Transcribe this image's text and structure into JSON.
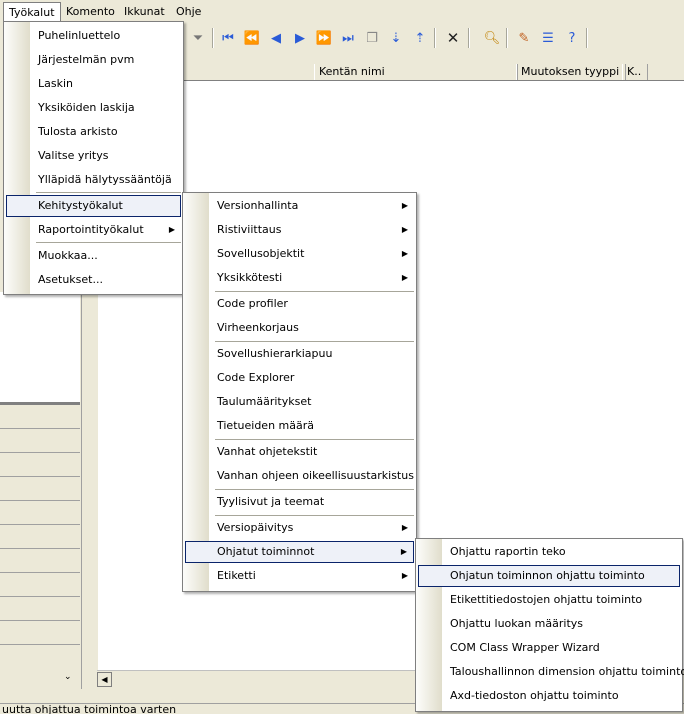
{
  "menubar": {
    "items": [
      "Työkalut",
      "Komento",
      "Ikkunat",
      "Ohje"
    ]
  },
  "toolbar": {
    "icons": [
      "filter-icon",
      "first-icon",
      "prev-page-icon",
      "prev-icon",
      "next-icon",
      "next-page-icon",
      "last-icon",
      "copy-icon",
      "import-icon",
      "export-icon",
      "delete-icon",
      "find-icon",
      "edit-icon",
      "list-icon",
      "help-icon"
    ]
  },
  "columns": [
    "Kentän nimi",
    "Muutoksen tyyppi",
    "K.."
  ],
  "status": {
    "text": "uutta ohjattua toimintoa varten"
  },
  "menu_tools": {
    "items": [
      "Puhelinluettelo",
      "Järjestelmän pvm",
      "Laskin",
      "Yksiköiden laskija",
      "Tulosta arkisto",
      "Valitse yritys",
      "Ylläpidä hälytyssääntöjä",
      "Kehitystyökalut",
      "Raportointityökalut",
      "Muokkaa...",
      "Asetukset..."
    ]
  },
  "menu_dev": {
    "items": [
      "Versionhallinta",
      "Ristiviittaus",
      "Sovellusobjektit",
      "Yksikkötesti",
      "Code profiler",
      "Virheenkorjaus",
      "Sovellushierarkiapuu",
      "Code Explorer",
      "Taulumääritykset",
      "Tietueiden määrä",
      "Vanhat ohjetekstit",
      "Vanhan ohjeen oikeellisuustarkistus",
      "Tyylisivut ja teemat",
      "Versiopäivitys",
      "Ohjatut toiminnot",
      "Etiketti"
    ]
  },
  "menu_wizards": {
    "items": [
      "Ohjattu raportin teko",
      "Ohjatun toiminnon ohjattu toiminto",
      "Etikettitiedostojen ohjattu toiminto",
      "Ohjattu luokan määritys",
      "COM Class Wrapper Wizard",
      "Taloushallinnon dimension ohjattu toiminto",
      "Axd-tiedoston ohjattu toiminto"
    ]
  }
}
